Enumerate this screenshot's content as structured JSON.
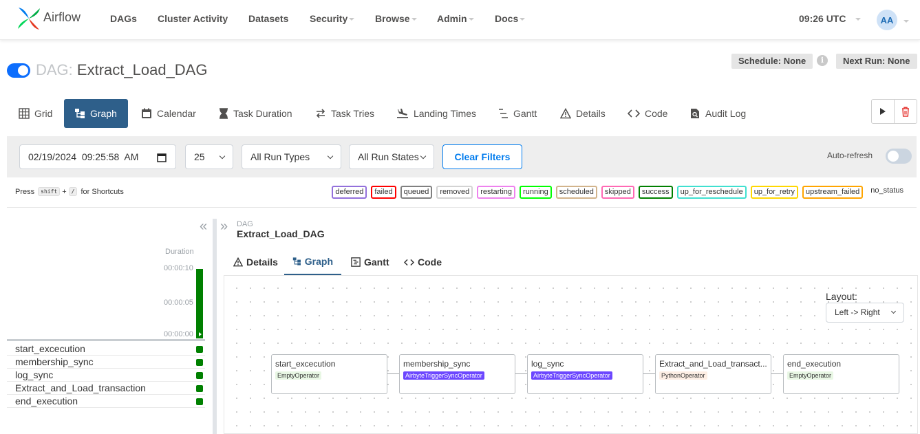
{
  "navbar": {
    "brand": "Airflow",
    "items": [
      {
        "label": "DAGs",
        "dropdown": false
      },
      {
        "label": "Cluster Activity",
        "dropdown": false
      },
      {
        "label": "Datasets",
        "dropdown": false
      },
      {
        "label": "Security",
        "dropdown": true
      },
      {
        "label": "Browse",
        "dropdown": true
      },
      {
        "label": "Admin",
        "dropdown": true
      },
      {
        "label": "Docs",
        "dropdown": true
      }
    ],
    "time": "09:26 UTC",
    "user_initials": "AA"
  },
  "dag": {
    "prefix": "DAG:",
    "name": "Extract_Load_DAG",
    "schedule": "Schedule: None",
    "next_run": "Next Run: None",
    "paused": false
  },
  "view_tabs": [
    {
      "label": "Grid",
      "icon": "grid-icon"
    },
    {
      "label": "Graph",
      "icon": "graph-icon",
      "active": true
    },
    {
      "label": "Calendar",
      "icon": "calendar-icon"
    },
    {
      "label": "Task Duration",
      "icon": "hourglass-icon"
    },
    {
      "label": "Task Tries",
      "icon": "retry-icon"
    },
    {
      "label": "Landing Times",
      "icon": "plane-landing-icon"
    },
    {
      "label": "Gantt",
      "icon": "gantt-icon"
    },
    {
      "label": "Details",
      "icon": "warning-triangle-icon"
    },
    {
      "label": "Code",
      "icon": "code-icon"
    },
    {
      "label": "Audit Log",
      "icon": "audit-log-icon"
    }
  ],
  "filters": {
    "base_date": "02/19/2024  09:25:58  AM",
    "num_runs": "25",
    "run_type": "All Run Types",
    "run_state": "All Run States",
    "clear_label": "Clear Filters",
    "auto_refresh_label": "Auto-refresh",
    "auto_refresh": false
  },
  "shortcuts": {
    "prefix": "Press",
    "key1": "shift",
    "plus": "+",
    "key2": "/",
    "suffix": "for Shortcuts"
  },
  "legend": [
    {
      "label": "deferred",
      "color": "#9370db"
    },
    {
      "label": "failed",
      "color": "#ff0000"
    },
    {
      "label": "queued",
      "color": "#808080"
    },
    {
      "label": "removed",
      "color": "#d3d3d3"
    },
    {
      "label": "restarting",
      "color": "#ee82ee"
    },
    {
      "label": "running",
      "color": "#00ff00"
    },
    {
      "label": "scheduled",
      "color": "#d2b48c"
    },
    {
      "label": "skipped",
      "color": "#ff69b4"
    },
    {
      "label": "success",
      "color": "#008000"
    },
    {
      "label": "up_for_reschedule",
      "color": "#40e0d0"
    },
    {
      "label": "up_for_retry",
      "color": "#ffd700"
    },
    {
      "label": "upstream_failed",
      "color": "#ffa500"
    },
    {
      "label": "no_status",
      "color": ""
    }
  ],
  "grid": {
    "duration_label": "Duration",
    "ticks": [
      "00:00:10",
      "00:00:05",
      "00:00:00"
    ],
    "tasks": [
      "start_excecution",
      "membership_sync",
      "log_sync",
      "Extract_and_Load_transaction",
      "end_execution"
    ]
  },
  "details": {
    "small_label": "DAG",
    "dag_name": "Extract_Load_DAG",
    "tabs": [
      {
        "label": "Details",
        "icon": "warning-triangle-icon"
      },
      {
        "label": "Graph",
        "icon": "graph-icon",
        "active": true
      },
      {
        "label": "Gantt",
        "icon": "gantt-icon"
      },
      {
        "label": "Code",
        "icon": "code-icon"
      }
    ],
    "layout_label": "Layout:",
    "layout_value": "Left -> Right"
  },
  "graph_nodes": [
    {
      "name": "start_excecution",
      "operator": "EmptyOperator",
      "op_bg": "#e8f7e4",
      "op_fg": "#333333"
    },
    {
      "name": "membership_sync",
      "operator": "AirbyteTriggerSyncOperator",
      "op_bg": "#6c47ff",
      "op_fg": "#ffffff"
    },
    {
      "name": "log_sync",
      "operator": "AirbyteTriggerSyncOperator",
      "op_bg": "#6c47ff",
      "op_fg": "#ffffff"
    },
    {
      "name": "Extract_and_Load_transact...",
      "operator": "PythonOperator",
      "op_bg": "#fdeee4",
      "op_fg": "#333333"
    },
    {
      "name": "end_execution",
      "operator": "EmptyOperator",
      "op_bg": "#e8f7e4",
      "op_fg": "#333333"
    }
  ]
}
